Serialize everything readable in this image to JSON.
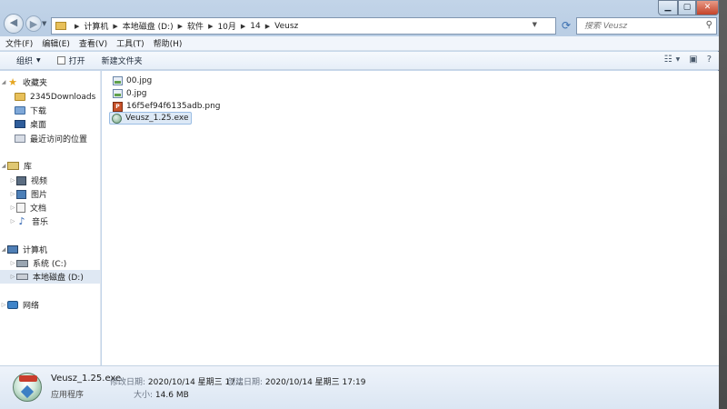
{
  "address": {
    "crumbs": [
      "计算机",
      "本地磁盘 (D:)",
      "软件",
      "10月",
      "14",
      "Veusz"
    ]
  },
  "search": {
    "placeholder": "搜索 Veusz"
  },
  "menu": [
    "文件(F)",
    "编辑(E)",
    "查看(V)",
    "工具(T)",
    "帮助(H)"
  ],
  "toolbar": {
    "organize": "组织",
    "open": "打开",
    "new_folder": "新建文件夹"
  },
  "sidebar": {
    "favorites": "收藏夹",
    "fav_items": [
      "2345Downloads",
      "下载",
      "桌面",
      "最近访问的位置"
    ],
    "libraries": "库",
    "lib_items": [
      "视频",
      "图片",
      "文档",
      "音乐"
    ],
    "computer": "计算机",
    "drives": [
      "系统 (C:)",
      "本地磁盘 (D:)"
    ],
    "network": "网络"
  },
  "files": [
    {
      "name": "00.jpg",
      "type": "jpg"
    },
    {
      "name": "0.jpg",
      "type": "jpg"
    },
    {
      "name": "16f5ef94f6135adb.png",
      "type": "png"
    },
    {
      "name": "Veusz_1.25.exe",
      "type": "exe"
    }
  ],
  "details": {
    "name": "Veusz_1.25.exe",
    "modified_label": "修改日期:",
    "modified_value": "2020/10/14 星期三 17...",
    "created_label": "创建日期:",
    "created_value": "2020/10/14 星期三 17:19",
    "type": "应用程序",
    "size_label": "大小:",
    "size_value": "14.6 MB"
  }
}
